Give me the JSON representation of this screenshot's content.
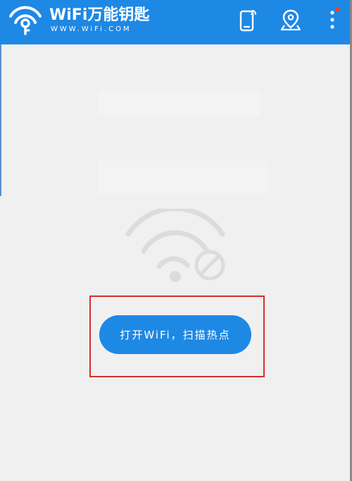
{
  "header": {
    "brand_name": "WiFi万能钥匙",
    "brand_url": "WWW.WiFi.COM",
    "logo_icon": "wifi-key-logo-icon",
    "actions": [
      {
        "icon": "phone-signal-icon"
      },
      {
        "icon": "location-pin-icon"
      },
      {
        "icon": "more-vertical-icon",
        "has_notification_dot": true
      }
    ]
  },
  "main": {
    "status_icon": "wifi-disabled-icon",
    "open_wifi_button_label": "打开WiFi，扫描热点"
  },
  "colors": {
    "primary": "#1e88e5",
    "background": "#f0f0f0",
    "icon_gray": "#dcdcdc",
    "highlight": "#d32f2f",
    "notification": "#ff3b30"
  }
}
